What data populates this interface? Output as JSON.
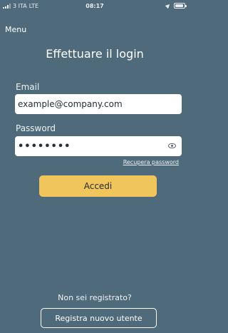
{
  "status_bar": {
    "carrier": "3 ITA",
    "network": "LTE",
    "time": "08:17"
  },
  "nav": {
    "menu_label": "Menu"
  },
  "login": {
    "title": "Effettuare il login",
    "email_label": "Email",
    "email_value": "example@company.com",
    "password_label": "Password",
    "password_value": "••••••••",
    "recover_label": "Recupera password",
    "submit_label": "Accedi"
  },
  "register": {
    "prompt": "Non sei registrato?",
    "button_label": "Registra nuovo utente"
  },
  "colors": {
    "background": "#4f6a7a",
    "accent_button": "#efc55c",
    "field_background": "#ffffff"
  },
  "icons": {
    "password_toggle": "eye-icon"
  }
}
